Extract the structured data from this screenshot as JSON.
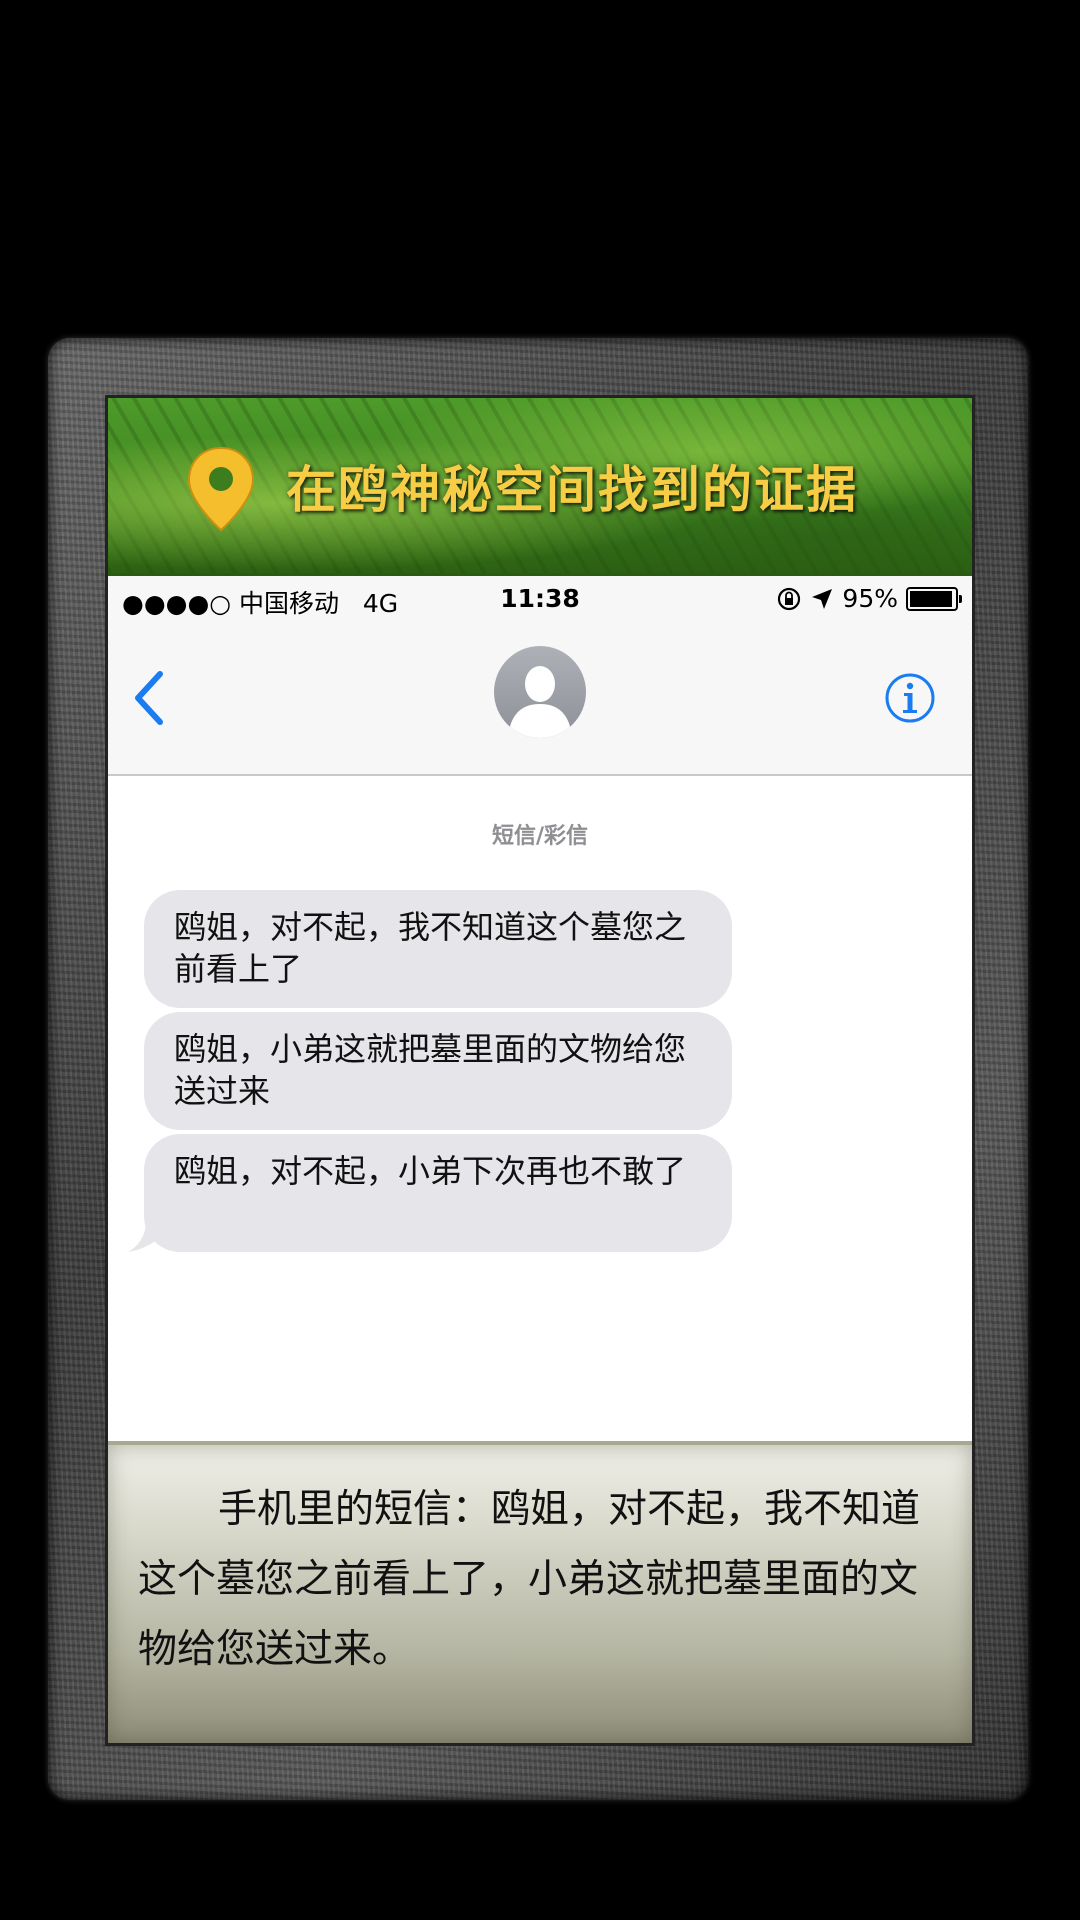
{
  "banner": {
    "icon": "location-pin-icon",
    "title": "在鸥神秘空间找到的证据"
  },
  "status_bar": {
    "signal": "●●●●○",
    "carrier": "中国移动",
    "network": "4G",
    "time": "11:38",
    "battery": "95%",
    "battery_level": 0.95
  },
  "nav": {
    "back_icon": "chevron-left-icon",
    "avatar_icon": "contact-avatar-icon",
    "info_icon": "info-icon"
  },
  "thread": {
    "label": "短信/彩信",
    "messages": [
      {
        "text": "鸥姐，对不起，我不知道这个墓您之前看上了"
      },
      {
        "text": "鸥姐，小弟这就把墓里面的文物给您送过来"
      },
      {
        "text": "鸥姐，对不起，小弟下次再也不敢了"
      }
    ]
  },
  "caption": {
    "text": "手机里的短信：鸥姐，对不起，我不知道这个墓您之前看上了，小弟这就把墓里面的文物给您送过来。"
  },
  "colors": {
    "banner_title": "#f7cd45",
    "pin": "#f5be2c",
    "ios_blue": "#1a7cf0",
    "bubble": "#e5e5ea"
  }
}
